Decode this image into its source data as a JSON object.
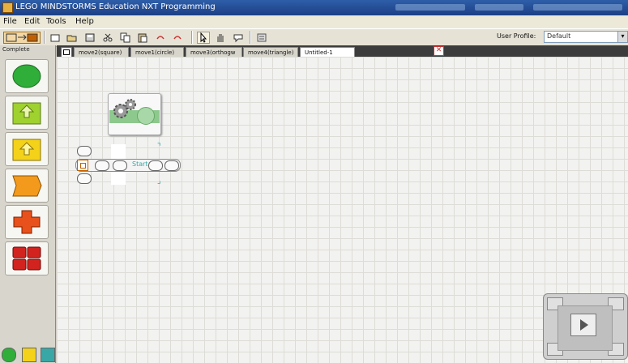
{
  "window": {
    "title": "LEGO MINDSTORMS Education NXT Programming"
  },
  "menu": [
    "File",
    "Edit",
    "Tools",
    "Help"
  ],
  "toolbar": {
    "profile_label": "User Profile:",
    "profile_value": "Default"
  },
  "palette": {
    "title": "Complete",
    "blocks": [
      {
        "name": "common",
        "color": "#2fae3a"
      },
      {
        "name": "action",
        "color": "#9fd12f"
      },
      {
        "name": "sensor",
        "color": "#f4d21a"
      },
      {
        "name": "flow",
        "color": "#f39a1c"
      },
      {
        "name": "data",
        "color": "#e8511b"
      },
      {
        "name": "advanced",
        "color": "#d2231f"
      }
    ]
  },
  "tabs": [
    {
      "label": "move2(square)",
      "active": false
    },
    {
      "label": "move1(circle)",
      "active": false
    },
    {
      "label": "move3(orthogw",
      "active": false
    },
    {
      "label": "move4(triangle)",
      "active": false
    },
    {
      "label": "Untitled-1",
      "active": true
    }
  ],
  "canvas": {
    "beam_label": "Start"
  },
  "colors": {
    "titlebar": "#1b3f86",
    "canvas_bg": "#f2f2f0",
    "move_band": "#8dc88d",
    "highlight": "#3aa7a7"
  }
}
